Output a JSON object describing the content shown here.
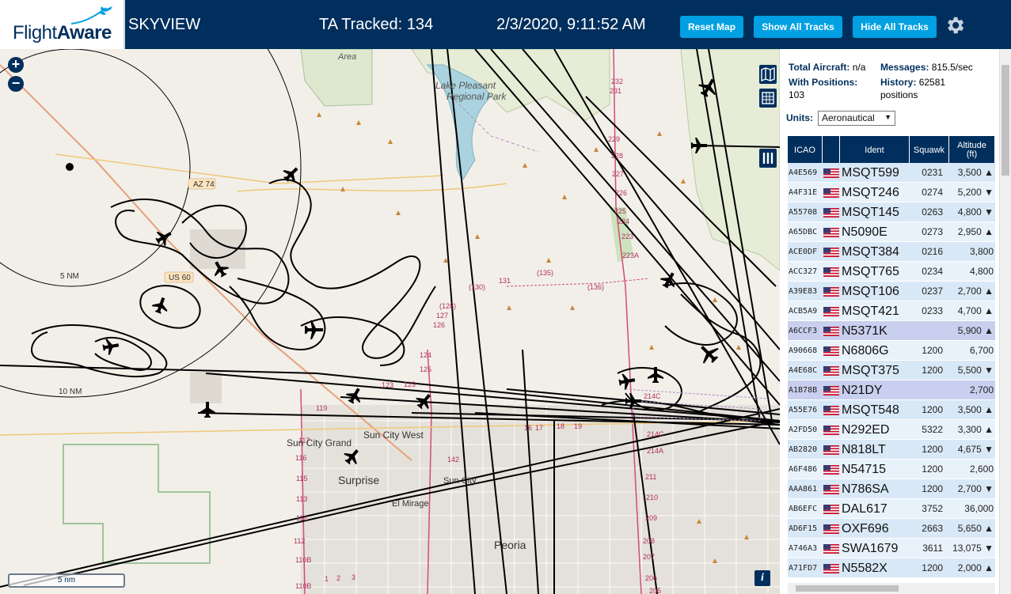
{
  "header": {
    "logo_flight": "Flight",
    "logo_aware": "Aware",
    "app_title": "SKYVIEW",
    "tracked": "TA Tracked: 134",
    "datetime": "2/3/2020, 9:11:52 AM",
    "reset_map": "Reset Map",
    "show_all": "Show All Tracks",
    "hide_all": "Hide All Tracks"
  },
  "map": {
    "zoom_in": "+",
    "zoom_out": "−",
    "scale": "5 nm",
    "info": "i",
    "ring_5": "5 NM",
    "ring_10": "10 NM",
    "labels": {
      "lake": "Lake Pleasant",
      "park": "Regional Park",
      "wilderness": "Area",
      "az74": "AZ 74",
      "us60": "US 60",
      "sun_city_grand": "Sun City Grand",
      "sun_city_west": "Sun City West",
      "surprise": "Surprise",
      "sun_city": "Sun City",
      "el_mirage": "El Mirage",
      "peoria": "Peoria"
    }
  },
  "sidebar": {
    "total_label": "Total Aircraft:",
    "total_value": "n/a",
    "messages_label": "Messages:",
    "messages_value": "815.5/sec",
    "positions_label": "With Positions:",
    "positions_value": "103",
    "history_label": "History:",
    "history_value": "62581",
    "history_unit": "positions",
    "units_label": "Units:",
    "units_value": "Aeronautical",
    "columns": {
      "icao": "ICAO",
      "ident": "Ident",
      "squawk": "Squawk",
      "alt1": "Altitude",
      "alt2": "(ft)"
    },
    "rows": [
      {
        "icao": "A4E569",
        "ident": "MSQT599",
        "squawk": "0231",
        "alt": "3,500 ▲",
        "style": "odd"
      },
      {
        "icao": "A4F31E",
        "ident": "MSQT246",
        "squawk": "0274",
        "alt": "5,200 ▼",
        "style": "even"
      },
      {
        "icao": "A55708",
        "ident": "MSQT145",
        "squawk": "0263",
        "alt": "4,800 ▼",
        "style": "odd"
      },
      {
        "icao": "A65DBC",
        "ident": "N5090E",
        "squawk": "0273",
        "alt": "2,950 ▲",
        "style": "even"
      },
      {
        "icao": "ACE0DF",
        "ident": "MSQT384",
        "squawk": "0216",
        "alt": "3,800",
        "style": "odd"
      },
      {
        "icao": "ACC327",
        "ident": "MSQT765",
        "squawk": "0234",
        "alt": "4,800",
        "style": "even"
      },
      {
        "icao": "A39E83",
        "ident": "MSQT106",
        "squawk": "0237",
        "alt": "2,700 ▲",
        "style": "odd"
      },
      {
        "icao": "ACB5A9",
        "ident": "MSQT421",
        "squawk": "0233",
        "alt": "4,700 ▲",
        "style": "even"
      },
      {
        "icao": "A6CCF3",
        "ident": "N5371K",
        "squawk": "",
        "alt": "5,900 ▲",
        "style": "sel"
      },
      {
        "icao": "A90668",
        "ident": "N6806G",
        "squawk": "1200",
        "alt": "6,700",
        "style": "even"
      },
      {
        "icao": "A4E68C",
        "ident": "MSQT375",
        "squawk": "1200",
        "alt": "5,500 ▼",
        "style": "odd"
      },
      {
        "icao": "A1B78B",
        "ident": "N21DY",
        "squawk": "",
        "alt": "2,700",
        "style": "sel"
      },
      {
        "icao": "A55E76",
        "ident": "MSQT548",
        "squawk": "1200",
        "alt": "3,500 ▲",
        "style": "odd"
      },
      {
        "icao": "A2FD50",
        "ident": "N292ED",
        "squawk": "5322",
        "alt": "3,300 ▲",
        "style": "even"
      },
      {
        "icao": "AB2820",
        "ident": "N818LT",
        "squawk": "1200",
        "alt": "4,675 ▼",
        "style": "odd"
      },
      {
        "icao": "A6F486",
        "ident": "N54715",
        "squawk": "1200",
        "alt": "2,600",
        "style": "even"
      },
      {
        "icao": "AAA861",
        "ident": "N786SA",
        "squawk": "1200",
        "alt": "2,700 ▼",
        "style": "odd"
      },
      {
        "icao": "AB6EFC",
        "ident": "DAL617",
        "squawk": "3752",
        "alt": "36,000",
        "style": "even"
      },
      {
        "icao": "AD6F15",
        "ident": "OXF696",
        "squawk": "2663",
        "alt": "5,650 ▲",
        "style": "odd"
      },
      {
        "icao": "A746A3",
        "ident": "SWA1679",
        "squawk": "3611",
        "alt": "13,075 ▼",
        "style": "even"
      },
      {
        "icao": "A71FD7",
        "ident": "N5582X",
        "squawk": "1200",
        "alt": "2,000 ▲",
        "style": "odd"
      }
    ]
  },
  "colors": {
    "header_bg": "#002f5d",
    "button": "#00a0e2",
    "map_bg": "#f2efe9",
    "row_odd": "#d9e8f6",
    "row_even": "#e8f2fb",
    "row_selected": "#c9cfee"
  }
}
